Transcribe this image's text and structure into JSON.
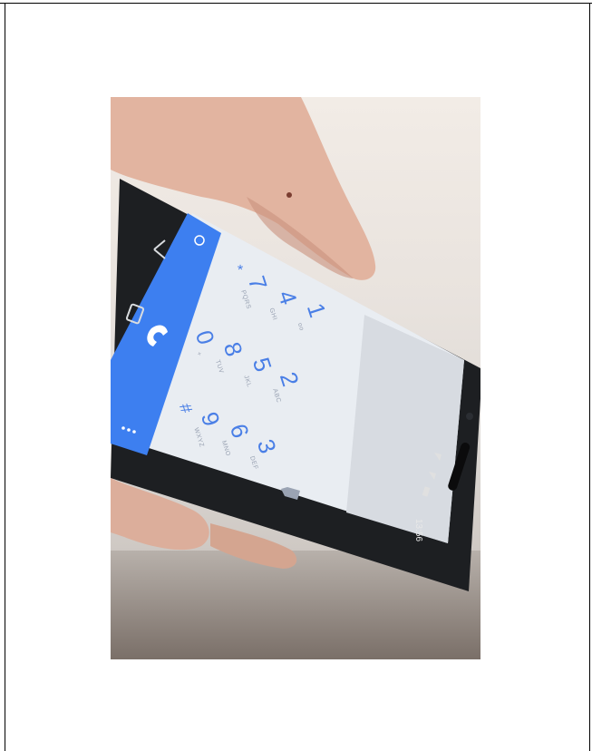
{
  "photo": {
    "subject": "hand-holding-phone-dialer",
    "status_time": "13:56",
    "keypad": [
      {
        "digit": "1",
        "letters": "oo"
      },
      {
        "digit": "2",
        "letters": "ABC"
      },
      {
        "digit": "3",
        "letters": "DEF"
      },
      {
        "digit": "4",
        "letters": "GHI"
      },
      {
        "digit": "5",
        "letters": "JKL"
      },
      {
        "digit": "6",
        "letters": "MNO"
      },
      {
        "digit": "7",
        "letters": "PQRS"
      },
      {
        "digit": "8",
        "letters": "TUV"
      },
      {
        "digit": "9",
        "letters": "WXYZ"
      },
      {
        "digit": "*",
        "letters": ""
      },
      {
        "digit": "0",
        "letters": "+"
      },
      {
        "digit": "#",
        "letters": ""
      }
    ],
    "colors": {
      "dialer_blue_bar": "#3d7ff0",
      "keypad_background": "#e9edf2",
      "digit_blue": "#4a7fe6",
      "phone_body": "#1d1f22",
      "skin": "#e6b8a6"
    }
  }
}
